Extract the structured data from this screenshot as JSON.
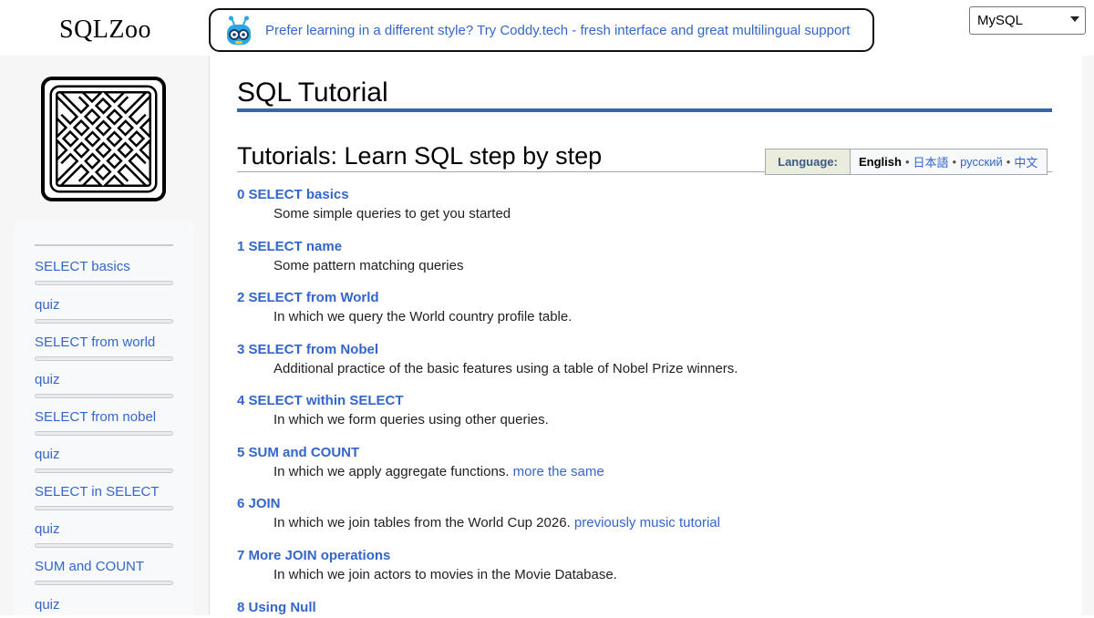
{
  "header": {
    "site_title": "SQLZoo",
    "promo_text": "Prefer learning in a different style? Try Coddy.tech - fresh interface and great multilingual support",
    "db_select": "MySQL"
  },
  "sidebar": {
    "items": [
      {
        "label": "SELECT basics"
      },
      {
        "label": "quiz"
      },
      {
        "label": "SELECT from world"
      },
      {
        "label": "quiz"
      },
      {
        "label": "SELECT from nobel"
      },
      {
        "label": "quiz"
      },
      {
        "label": "SELECT in SELECT"
      },
      {
        "label": "quiz"
      },
      {
        "label": "SUM and COUNT"
      },
      {
        "label": "quiz"
      }
    ]
  },
  "main": {
    "page_title": "SQL Tutorial",
    "section_title": "Tutorials: Learn SQL step by step",
    "language_box": {
      "label": "Language:",
      "current": "English",
      "others": [
        "日本語",
        "русский",
        "中文"
      ]
    },
    "tutorials": [
      {
        "title": "0 SELECT basics",
        "desc": "Some simple queries to get you started",
        "extra": ""
      },
      {
        "title": "1 SELECT name",
        "desc": "Some pattern matching queries",
        "extra": ""
      },
      {
        "title": "2 SELECT from World",
        "desc": "In which we query the World country profile table.",
        "extra": ""
      },
      {
        "title": "3 SELECT from Nobel",
        "desc": "Additional practice of the basic features using a table of Nobel Prize winners.",
        "extra": ""
      },
      {
        "title": "4 SELECT within SELECT",
        "desc": "In which we form queries using other queries.",
        "extra": ""
      },
      {
        "title": "5 SUM and COUNT",
        "desc": "In which we apply aggregate functions.",
        "extra": "more the same"
      },
      {
        "title": "6 JOIN",
        "desc": "In which we join tables from the World Cup 2026.",
        "extra": "previously music tutorial"
      },
      {
        "title": "7 More JOIN operations",
        "desc": "In which we join actors to movies in the Movie Database.",
        "extra": ""
      },
      {
        "title": "8 Using Null",
        "desc": "",
        "extra": ""
      }
    ]
  },
  "colors": {
    "link": "#3366cc",
    "title_rule": "#3b63a8",
    "panel_bg": "#f6f6f6"
  },
  "icons": [
    "robot-mascot-icon",
    "celtic-knot-logo",
    "chevron-down-icon"
  ]
}
